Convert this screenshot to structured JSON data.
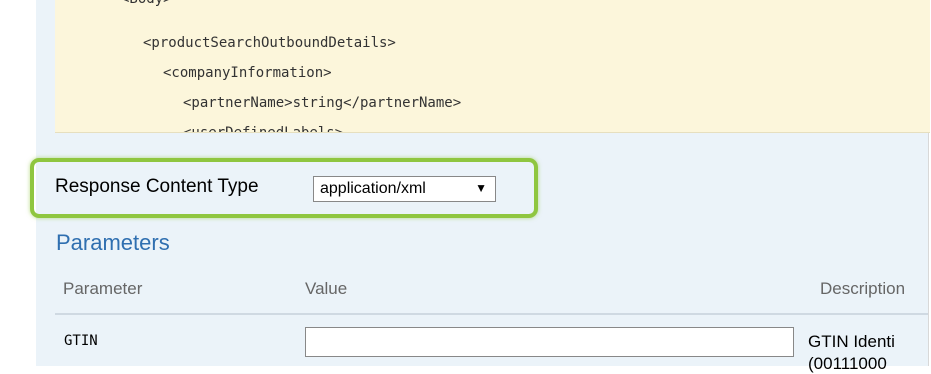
{
  "code_sample": {
    "lines": [
      "<Body>",
      "<productSearchOutboundDetails>",
      "<companyInformation>",
      "<partnerName>string</partnerName>",
      "<userDefinedLabels>"
    ]
  },
  "response_content_type": {
    "label": "Response Content Type",
    "selected": "application/xml",
    "arrow": "▼"
  },
  "parameters": {
    "title": "Parameters",
    "headers": {
      "parameter": "Parameter",
      "value": "Value",
      "description": "Description"
    },
    "rows": [
      {
        "name": "GTIN",
        "value": "",
        "description": "GTIN Identi",
        "description_line2": "(00111000"
      }
    ]
  },
  "colors": {
    "highlight": "#8fc640",
    "link_blue": "#2f6fb0",
    "code_bg": "#fcf6db",
    "panel_bg": "#ebf3f9"
  }
}
